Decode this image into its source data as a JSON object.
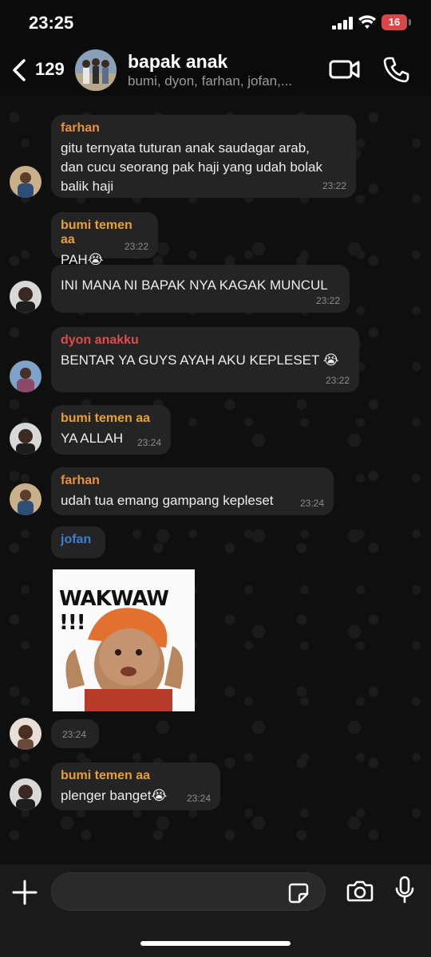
{
  "status_bar": {
    "time": "23:25",
    "battery": "16"
  },
  "header": {
    "back_count": "129",
    "title": "bapak anak",
    "members": "bumi, dyon, farhan, jofan,..."
  },
  "messages": [
    {
      "sender": "farhan",
      "color": "#e8903a",
      "text": "gitu ternyata tuturan anak saudagar arab, dan cucu seorang pak haji yang udah bolak balik haji",
      "time": "23:22"
    },
    {
      "sender": "bumi temen aa",
      "color": "#e8a030",
      "text": "PAH😭",
      "time": "23:22"
    },
    {
      "sender": "",
      "color": "",
      "text": "INI MANA NI BAPAK NYA KAGAK MUNCUL",
      "time": "23:22"
    },
    {
      "sender": "dyon anakku",
      "color": "#e04b4b",
      "text": "BENTAR YA GUYS AYAH AKU KEPLESET 😭",
      "time": "23:22"
    },
    {
      "sender": "bumi temen aa",
      "color": "#e8a030",
      "text": "YA ALLAH",
      "time": "23:24"
    },
    {
      "sender": "farhan",
      "color": "#e8903a",
      "text": "udah tua emang gampang kepleset",
      "time": "23:24"
    },
    {
      "sender": "jofan",
      "color": "#3a7fd6",
      "text": "",
      "time": "23:24",
      "sticker_text": "WAKWAW !!!"
    },
    {
      "sender": "bumi temen aa",
      "color": "#e8a030",
      "text": "plenger banget😭",
      "time": "23:24"
    }
  ],
  "input": {
    "placeholder": ""
  },
  "icons": {
    "back": "chevron-left-icon",
    "video": "video-camera-icon",
    "phone": "phone-icon",
    "plus": "plus-icon",
    "sticker": "sticker-icon",
    "camera": "camera-icon",
    "mic": "microphone-icon"
  }
}
